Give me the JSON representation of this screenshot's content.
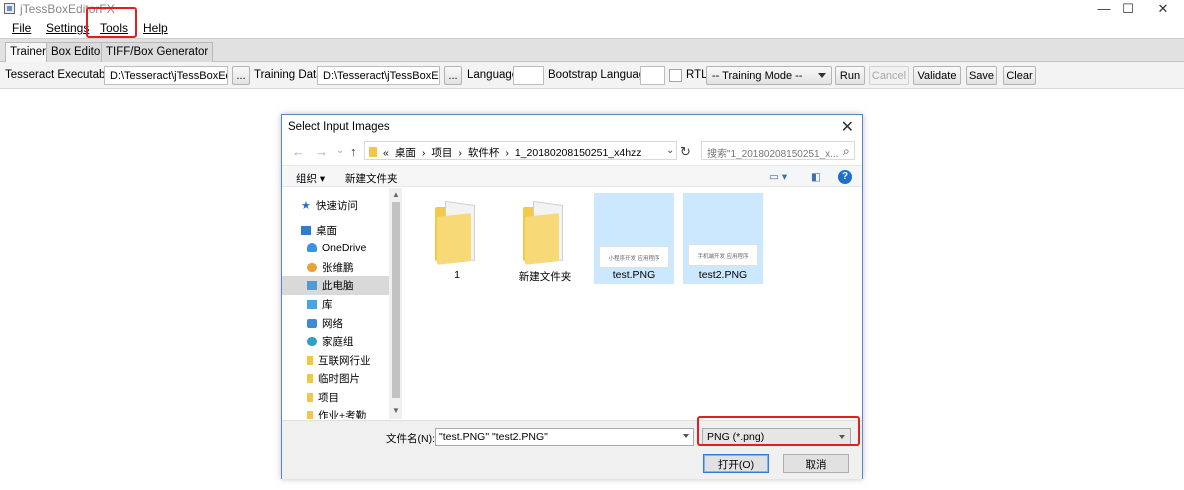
{
  "window": {
    "title": "jTessBoxEditorFX",
    "controls": [
      "—",
      "☐",
      "✕"
    ]
  },
  "menu": {
    "items": [
      "File",
      "Settings",
      "Tools",
      "Help"
    ]
  },
  "tabs": [
    "Trainer",
    "Box Editor",
    "TIFF/Box Generator"
  ],
  "toolbar": {
    "exec_label": "Tesseract Executables",
    "exec_path": "D:\\Tesseract\\jTessBoxEdit",
    "browse": "...",
    "training_label": "Training Data",
    "training_path": "D:\\Tesseract\\jTessBoxEdit",
    "language_label": "Language",
    "language_value": "",
    "bootstrap_label": "Bootstrap Language",
    "bootstrap_value": "",
    "rtl_label": "RTL",
    "mode": "-- Training Mode --",
    "run": "Run",
    "cancel": "Cancel",
    "validate": "Validate",
    "save": "Save",
    "clear": "Clear"
  },
  "dialog": {
    "title": "Select Input Images",
    "close": "✕",
    "nav": {
      "back": "←",
      "forward": "→",
      "down": "⌄",
      "up": "↑"
    },
    "path": [
      "«",
      "桌面",
      "›",
      "项目",
      "›",
      "软件杯",
      "›",
      "1_20180208150251_x4hzz"
    ],
    "path_dropdown": "⌄",
    "refresh": "↻",
    "search_placeholder": "搜索\"1_20180208150251_x...",
    "search_icon": "⌕",
    "organize": "组织 ▾",
    "new_folder": "新建文件夹",
    "view_icons": [
      "▭ ▾",
      "◧"
    ],
    "help": "?",
    "nav_items": [
      {
        "label": "快速访问",
        "icon": "star"
      },
      {
        "label": "桌面",
        "icon": "desktop"
      },
      {
        "label": "OneDrive",
        "icon": "cloud"
      },
      {
        "label": "张维鹏",
        "icon": "user"
      },
      {
        "label": "此电脑",
        "icon": "pc"
      },
      {
        "label": "库",
        "icon": "lib"
      },
      {
        "label": "网络",
        "icon": "net"
      },
      {
        "label": "家庭组",
        "icon": "home"
      },
      {
        "label": "互联网行业",
        "icon": "fold"
      },
      {
        "label": "临时图片",
        "icon": "fold"
      },
      {
        "label": "项目",
        "icon": "fold"
      },
      {
        "label": "作业+考勤",
        "icon": "fold"
      }
    ],
    "scroll_arrows": [
      "▲",
      "▼"
    ],
    "files": [
      {
        "name": "1",
        "type": "folder",
        "selected": false
      },
      {
        "name": "新建文件夹",
        "type": "folder",
        "selected": false
      },
      {
        "name": "test.PNG",
        "type": "image",
        "selected": true,
        "preview": "小程序开发 应用程序"
      },
      {
        "name": "test2.PNG",
        "type": "image",
        "selected": true,
        "preview": "手机端开发 应用程序"
      }
    ],
    "filename_label": "文件名(N):",
    "filename_value": "\"test.PNG\" \"test2.PNG\"",
    "filetype": "PNG (*.png)",
    "open": "打开(O)",
    "cancel": "取消"
  },
  "colors": {
    "highlight_red": "#e02020",
    "selection_blue": "#cce8ff",
    "dialog_border": "#5a87c7"
  }
}
